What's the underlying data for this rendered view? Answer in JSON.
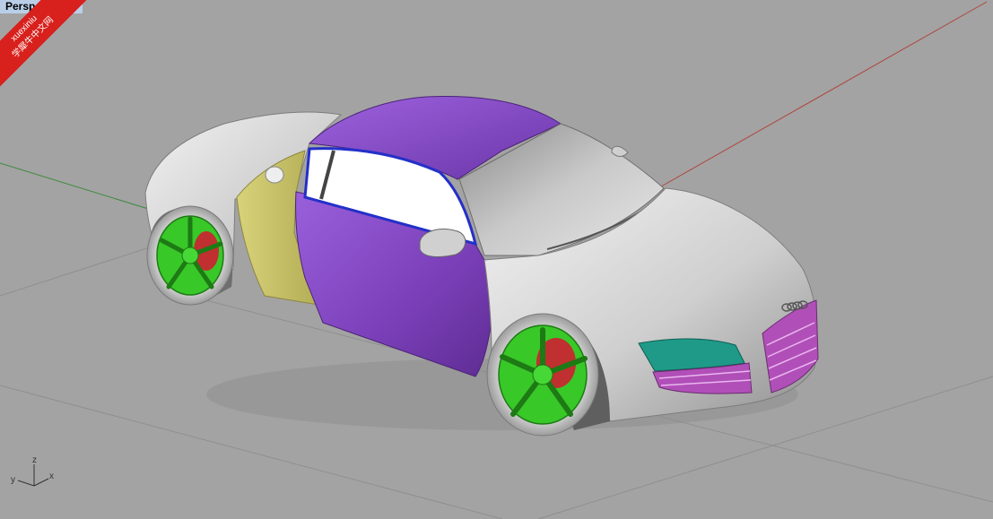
{
  "viewport": {
    "title": "Perspective",
    "background": "#a3a3a3"
  },
  "watermark": {
    "line1": "xuexiniu",
    "line2": "学犀牛中文网",
    "color": "#d8201c"
  },
  "axes": {
    "z_label": "z",
    "y_label": "y",
    "x_label": "x",
    "x_axis_color": "#b0453c",
    "y_axis_color": "#3d8a3d"
  },
  "model": {
    "name": "Audi R8",
    "colors": {
      "body": "#d4d4d4",
      "door": "#7a3fb8",
      "roof": "#8247c2",
      "side_blade": "#c8c26a",
      "wheels": "#38c828",
      "brake": "#c03030",
      "headlight": "#1f9a88",
      "grille": "#b14fb8",
      "window": "#ffffff",
      "window_trim": "#2430c8"
    }
  }
}
